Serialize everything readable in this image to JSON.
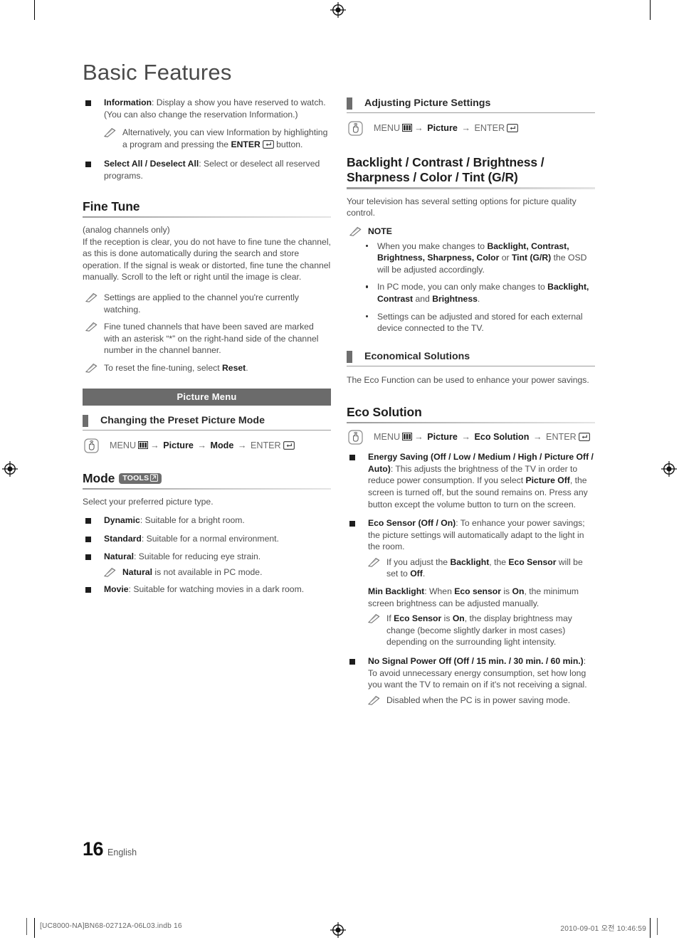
{
  "document": {
    "title": "Basic Features",
    "page_number": "16",
    "language": "English"
  },
  "print_marks": {
    "file_name": "[UC8000-NA]BN68-02712A-06L03.indb   16",
    "timestamp": "2010-09-01   오전 10:46:59"
  },
  "left_column": {
    "intro_bullets": [
      {
        "term": "Information",
        "text": ": Display a show you have reserved to watch. (You can also change the reservation Information.)"
      },
      {
        "term": "Select All / Deselect All",
        "text": ": Select or deselect all reserved programs."
      }
    ],
    "information_note": "Alternatively, you can view Information by highlighting a program and pressing the",
    "information_note_tail": "button.",
    "information_note_key": "ENTER",
    "fine_tune": {
      "heading": "Fine Tune",
      "subtitle": "(analog channels only)",
      "body": "If the reception is clear, you do not have to fine tune the channel, as this is done automatically during the search and store operation. If the signal is weak or distorted, fine tune the channel manually. Scroll to the left or right until the image is clear.",
      "notes": [
        "Settings are applied to the channel you're currently watching.",
        "Fine tuned channels that have been saved are marked with an asterisk “*” on the right-hand side of the channel number in the channel banner."
      ],
      "note_reset_prefix": "To reset the fine-tuning, select ",
      "note_reset_bold": "Reset",
      "note_reset_suffix": "."
    },
    "picture_menu_band": "Picture Menu",
    "changing_preset": {
      "heading": "Changing the Preset Picture Mode",
      "menu_path": {
        "menu": "MENU",
        "step1": "Picture",
        "step2": "Mode",
        "enter": "ENTER"
      }
    },
    "mode": {
      "heading": "Mode",
      "tools_badge": "TOOLS",
      "intro": "Select your preferred picture type.",
      "options": [
        {
          "term": "Dynamic",
          "text": ": Suitable for a bright room."
        },
        {
          "term": "Standard",
          "text": ": Suitable for a normal environment."
        },
        {
          "term": "Natural",
          "text": ": Suitable for reducing eye strain."
        },
        {
          "term": "Movie",
          "text": ": Suitable for watching movies in a dark room."
        }
      ],
      "natural_note_bold": "Natural",
      "natural_note_tail": " is not available in PC mode."
    }
  },
  "right_column": {
    "adjusting_picture": {
      "heading": "Adjusting Picture Settings",
      "menu_path": {
        "menu": "MENU",
        "step1": "Picture",
        "enter": "ENTER"
      }
    },
    "backlight_section": {
      "heading_line1": "Backlight / Contrast / Brightness /",
      "heading_line2": "Sharpness / Color / Tint (G/R)",
      "body": "Your television has several setting options for picture quality control.",
      "note_label": "NOTE",
      "notes": [
        {
          "segments": [
            {
              "text": "When you make changes to ",
              "bold": false
            },
            {
              "text": "Backlight, Contrast, Brightness, Sharpness, Color",
              "bold": true
            },
            {
              "text": " or ",
              "bold": false
            },
            {
              "text": "Tint (G/R)",
              "bold": true
            },
            {
              "text": " the OSD will be adjusted accordingly.",
              "bold": false
            }
          ]
        },
        {
          "segments": [
            {
              "text": "In PC mode, you can only make changes to ",
              "bold": false
            },
            {
              "text": "Backlight, Contrast",
              "bold": true
            },
            {
              "text": " and ",
              "bold": false
            },
            {
              "text": "Brightness",
              "bold": true
            },
            {
              "text": ".",
              "bold": false
            }
          ]
        },
        {
          "segments": [
            {
              "text": "Settings can be adjusted and stored for each external device connected to the TV.",
              "bold": false
            }
          ]
        }
      ]
    },
    "economical_solutions": {
      "heading": "Economical Solutions",
      "body": "The Eco Function can be used to enhance your power savings."
    },
    "eco_solution": {
      "heading": "Eco Solution",
      "menu_path": {
        "menu": "MENU",
        "step1": "Picture",
        "step2": "Eco Solution",
        "enter": "ENTER"
      },
      "energy_saving": {
        "term": "Energy Saving (Off / Low / Medium / High / Picture Off / Auto)",
        "text_1": ": This adjusts the brightness of the TV in order to reduce power consumption. If you select ",
        "bold_2": "Picture Off",
        "text_3": ", the screen is turned off, but the sound remains on. Press any button except the volume button to turn on the screen."
      },
      "eco_sensor": {
        "term": "Eco Sensor (Off / On)",
        "text": ": To enhance your power savings; the picture settings will automatically adapt to the light in the room.",
        "note_1": "If you adjust the ",
        "note_1_b1": "Backlight",
        "note_1_mid": ", the ",
        "note_1_b2": "Eco Sensor",
        "note_1_mid2": " will be set to ",
        "note_1_b3": "Off",
        "note_1_end": "."
      },
      "min_backlight": {
        "term": "Min Backlight",
        "text_1": ": When ",
        "bold_1": "Eco sensor",
        "text_2": " is ",
        "bold_2": "On",
        "text_3": ", the minimum screen brightness can be adjusted manually.",
        "note_pre": "If ",
        "note_b1": "Eco Sensor",
        "note_mid": " is ",
        "note_b2": "On",
        "note_end": ", the display brightness may change (become slightly darker in most cases) depending on the surrounding light intensity."
      },
      "no_signal_power_off": {
        "term": "No Signal Power Off (Off / 15 min. / 30 min. / 60 min.)",
        "text": ": To avoid unnecessary energy consumption, set how long you want the TV to remain on if it's not receiving a signal.",
        "note": "Disabled when the PC is in power saving mode."
      }
    }
  },
  "colors": {
    "band_bg": "#6b6b6b",
    "heading_text": "#1d1d1d",
    "body_text": "#4e4e4e"
  }
}
